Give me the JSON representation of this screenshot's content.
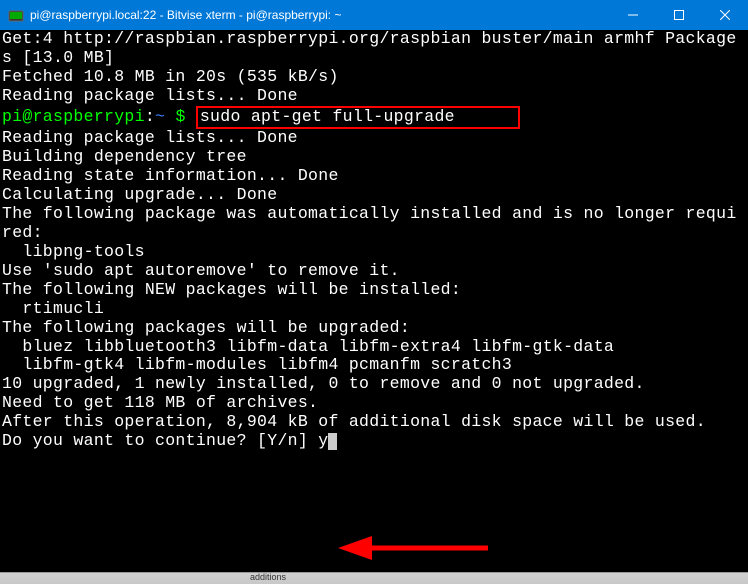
{
  "titlebar": {
    "title": "pi@raspberrypi.local:22 - Bitvise xterm - pi@raspberrypi: ~"
  },
  "terminal": {
    "lines": {
      "l0": "Get:4 http://raspbian.raspberrypi.org/raspbian buster/main armhf Packages [13.0 MB]",
      "l1": "Fetched 10.8 MB in 20s (535 kB/s)",
      "l2": "Reading package lists... Done",
      "prompt_user": "pi@raspberrypi",
      "prompt_path": "~",
      "prompt_symbol": "$",
      "command": "sudo apt-get full-upgrade",
      "l3": "Reading package lists... Done",
      "l4": "Building dependency tree",
      "l5": "Reading state information... Done",
      "l6": "Calculating upgrade... Done",
      "l7": "The following package was automatically installed and is no longer required:",
      "l8": "  libpng-tools",
      "l9": "Use 'sudo apt autoremove' to remove it.",
      "l10": "The following NEW packages will be installed:",
      "l11": "  rtimucli",
      "l12": "The following packages will be upgraded:",
      "l13": "  bluez libbluetooth3 libfm-data libfm-extra4 libfm-gtk-data",
      "l14": "  libfm-gtk4 libfm-modules libfm4 pcmanfm scratch3",
      "l15": "10 upgraded, 1 newly installed, 0 to remove and 0 not upgraded.",
      "l16": "Need to get 118 MB of archives.",
      "l17": "After this operation, 8,904 kB of additional disk space will be used.",
      "l18": "Do you want to continue? [Y/n] ",
      "input": "y"
    }
  },
  "taskbar": {
    "text": "additions"
  }
}
